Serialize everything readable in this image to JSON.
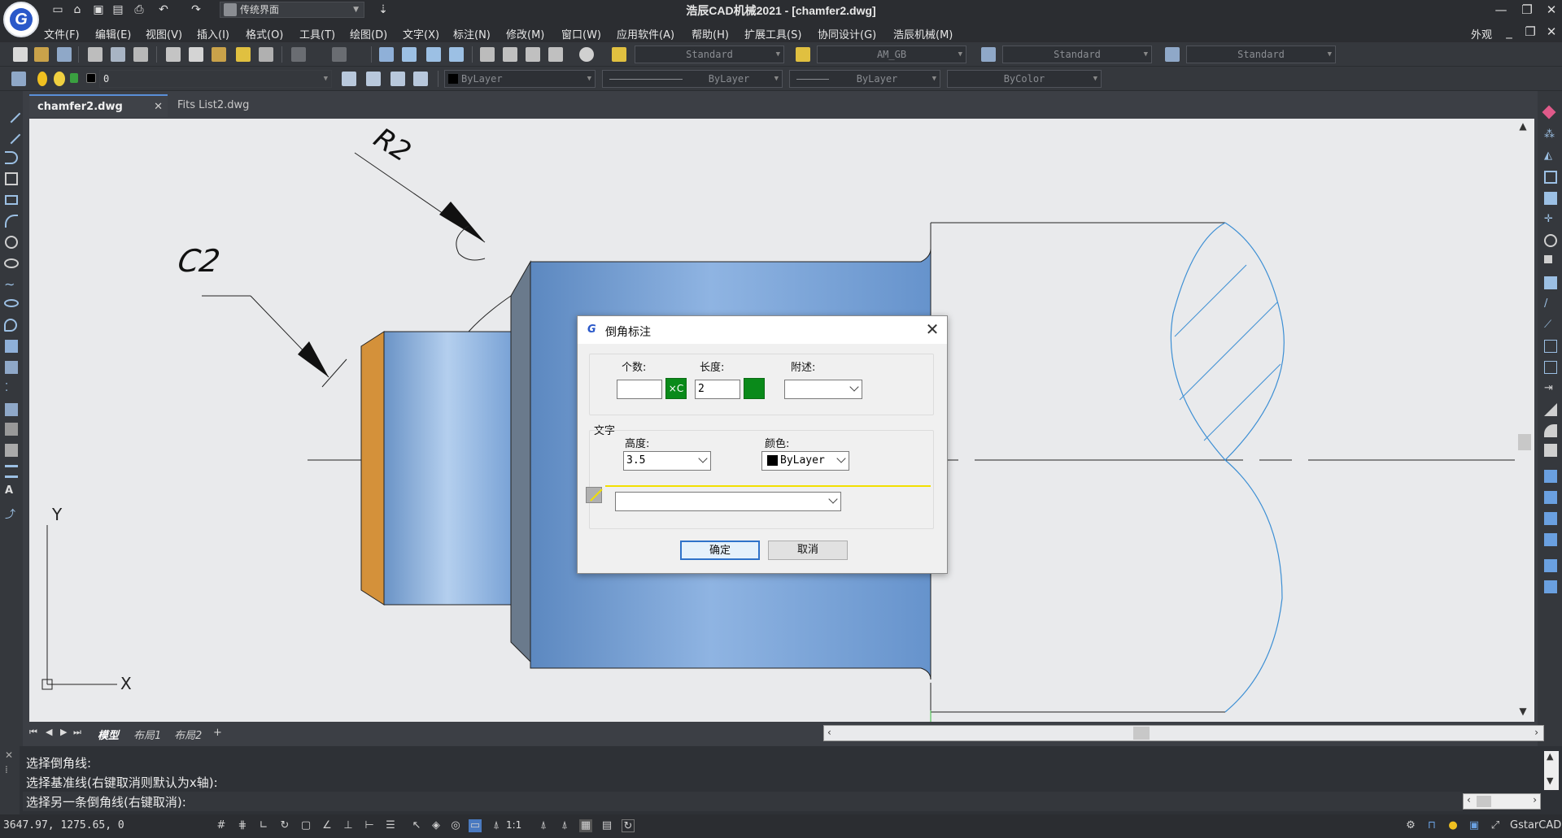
{
  "window": {
    "title": "浩辰CAD机械2021 - [chamfer2.dwg]",
    "workspace": "传统界面",
    "appearance": "外观"
  },
  "menu": [
    "文件(F)",
    "编辑(E)",
    "视图(V)",
    "插入(I)",
    "格式(O)",
    "工具(T)",
    "绘图(D)",
    "文字(X)",
    "标注(N)",
    "修改(M)",
    "窗口(W)",
    "应用软件(A)",
    "帮助(H)",
    "扩展工具(S)",
    "协同设计(G)",
    "浩辰机械(M)"
  ],
  "toolbar": {
    "text_style": "Standard",
    "dim_style": "AM_GB",
    "table_style": "Standard",
    "multileader_style": "Standard",
    "layer": "0",
    "color": "ByLayer",
    "linetype": "ByLayer",
    "lineweight": "ByLayer",
    "plotstyle": "ByColor"
  },
  "tabs": {
    "active": "chamfer2.dwg",
    "other": "Fits List2.dwg"
  },
  "drawing": {
    "chamfer_label": "C2",
    "radius_label": "R2",
    "ucs_x": "X",
    "ucs_y": "Y",
    "colors": {
      "shaft_blue": "#7ba7d8",
      "chamfer_orange": "#d4913a",
      "step_gray": "#6a7a8c",
      "hatch_line": "#3d8fd4",
      "outline": "#222222"
    }
  },
  "layout_tabs": [
    "模型",
    "布局1",
    "布局2",
    "+"
  ],
  "command": {
    "lines": [
      "选择倒角线:",
      "选择基准线(右键取消则默认为x轴):",
      "选择另一条倒角线(右键取消):"
    ]
  },
  "status": {
    "coordinates": "3647.97, 1275.65, 0",
    "scale": "1:1",
    "brand": "GstarCAD"
  },
  "dialog": {
    "title": "倒角标注",
    "count_label": "个数:",
    "count_value": "",
    "count_suffix": "×C",
    "length_label": "长度:",
    "length_value": "2",
    "note_label": "附述:",
    "note_value": "",
    "text_group": "文字",
    "height_label": "高度:",
    "height_value": "3.5",
    "color_label": "颜色:",
    "color_value": "ByLayer",
    "ok": "确定",
    "cancel": "取消"
  }
}
